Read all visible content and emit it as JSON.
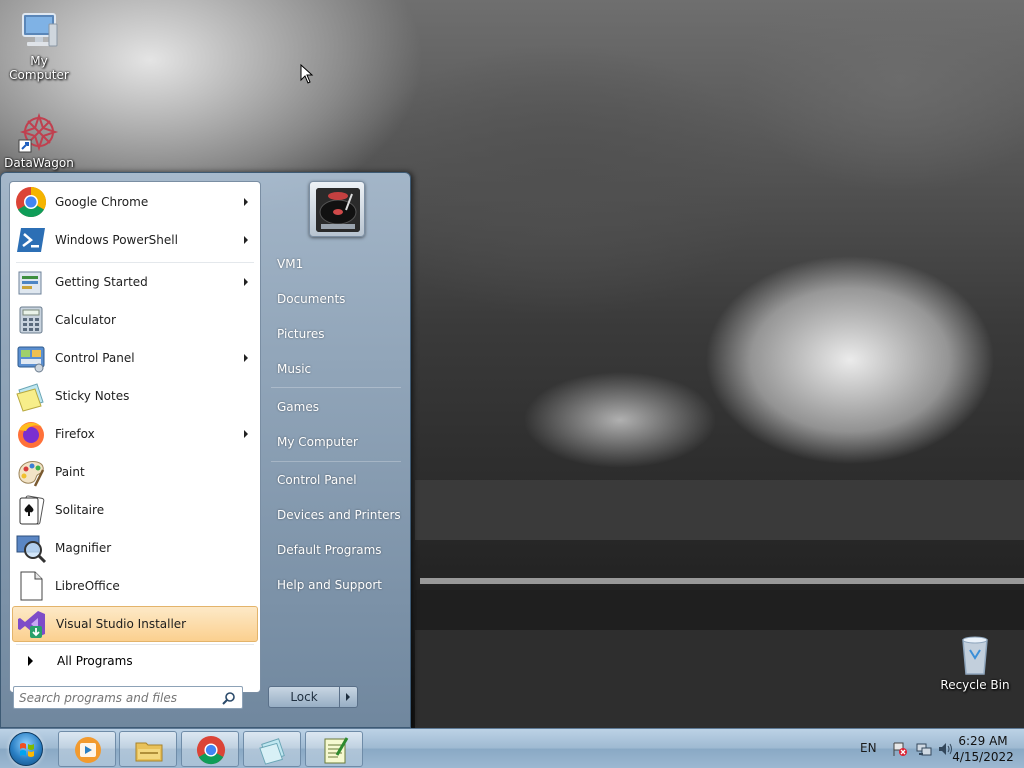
{
  "desktop": {
    "icons": [
      {
        "label": "My Computer"
      },
      {
        "label": "DataWagon"
      },
      {
        "label": "Recycle Bin"
      }
    ]
  },
  "start_menu": {
    "pinned": [
      {
        "label": "Google Chrome",
        "icon": "chrome-icon",
        "has_submenu": true
      },
      {
        "label": "Windows PowerShell",
        "icon": "powershell-icon",
        "has_submenu": true
      }
    ],
    "recent": [
      {
        "label": "Getting Started",
        "icon": "getting-started-icon",
        "has_submenu": true
      },
      {
        "label": "Calculator",
        "icon": "calculator-icon",
        "has_submenu": false
      },
      {
        "label": "Control Panel",
        "icon": "control-panel-icon",
        "has_submenu": true
      },
      {
        "label": "Sticky Notes",
        "icon": "sticky-notes-icon",
        "has_submenu": false
      },
      {
        "label": "Firefox",
        "icon": "firefox-icon",
        "has_submenu": true
      },
      {
        "label": "Paint",
        "icon": "paint-icon",
        "has_submenu": false
      },
      {
        "label": "Solitaire",
        "icon": "solitaire-icon",
        "has_submenu": false
      },
      {
        "label": "Magnifier",
        "icon": "magnifier-icon",
        "has_submenu": false
      },
      {
        "label": "LibreOffice",
        "icon": "libreoffice-icon",
        "has_submenu": false
      },
      {
        "label": "Visual Studio Installer",
        "icon": "visual-studio-installer-icon",
        "has_submenu": false,
        "highlighted": true
      }
    ],
    "all_programs": "All Programs",
    "search_placeholder": "Search programs and files",
    "right_items": [
      "VM1",
      "Documents",
      "Pictures",
      "Music",
      "Games",
      "My Computer",
      "Control Panel",
      "Devices and Printers",
      "Default Programs",
      "Help and Support"
    ],
    "lock_label": "Lock"
  },
  "taskbar": {
    "pinned": [
      "media-player-icon",
      "file-explorer-icon",
      "chrome-icon",
      "sticky-notes-icon",
      "notepad-plus-plus-icon"
    ],
    "tray": {
      "language": "EN",
      "time": "6:29 AM",
      "date": "4/15/2022"
    }
  },
  "colors": {
    "highlight": "#fbd08f",
    "menu_right_pane": "#8aa4bd",
    "taskbar": "#9fbad2"
  }
}
